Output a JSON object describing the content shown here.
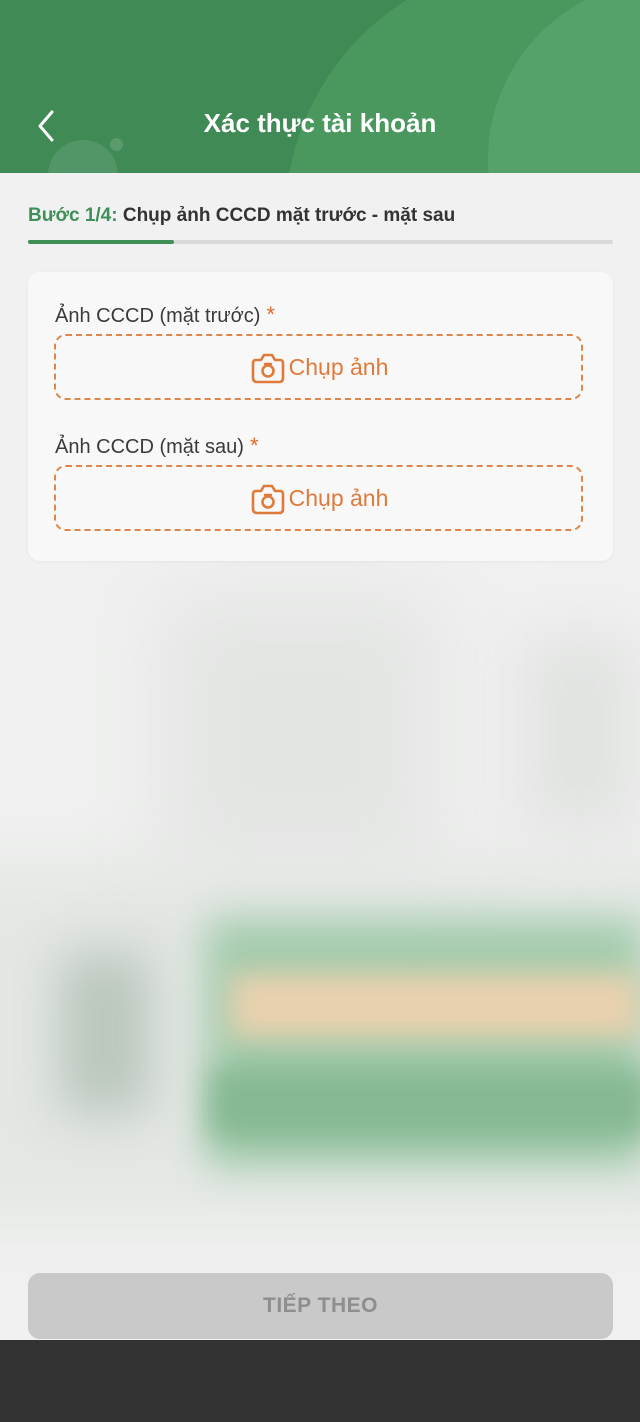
{
  "header": {
    "title": "Xác thực tài khoản",
    "back_icon": "chevron-left-icon",
    "colors": {
      "primary": "#3f8a55",
      "accent": "#e07a3a"
    }
  },
  "step": {
    "lead": "Bước 1/4:",
    "text": "Chụp ảnh CCCD mặt trước - mặt sau",
    "progress": 0.25
  },
  "form": {
    "front": {
      "label": "Ảnh CCCD (mặt trước)",
      "required_mark": "*",
      "button_label": "Chụp ảnh",
      "icon": "camera-icon"
    },
    "back": {
      "label": "Ảnh CCCD (mặt sau)",
      "required_mark": "*",
      "button_label": "Chụp ảnh",
      "icon": "camera-icon"
    }
  },
  "footer": {
    "next_label": "TIẾP THEO"
  }
}
